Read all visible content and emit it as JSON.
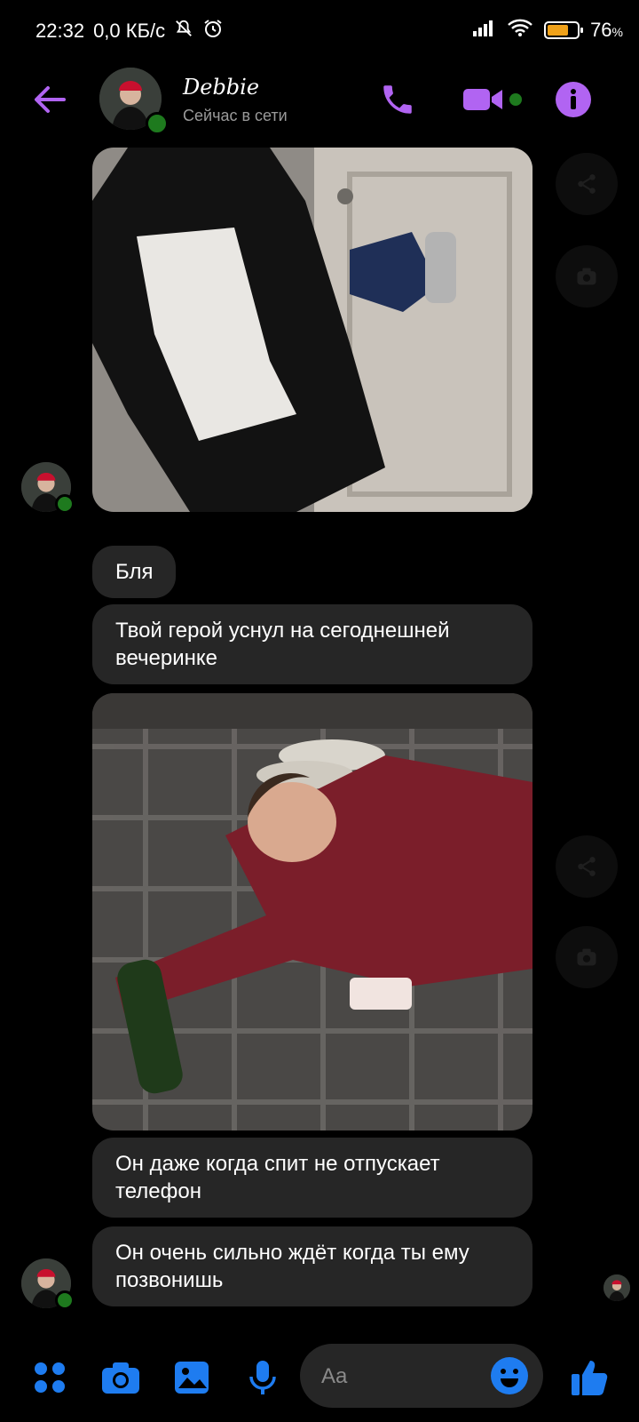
{
  "status_bar": {
    "time": "22:32",
    "speed": "0,0 КБ/с",
    "battery_percent": "76",
    "battery_suffix": "%",
    "battery_level": 0.76,
    "battery_color": "#f0a21a"
  },
  "header": {
    "name": "Debbie",
    "status": "Сейчас в сети",
    "accent_color": "#b164f2",
    "online_color": "#1e7a1e"
  },
  "messages": [
    {
      "type": "image",
      "icon": "photo-hoodie-door"
    },
    {
      "type": "text",
      "text": "Бля"
    },
    {
      "type": "text",
      "text": "Твой герой уснул на сегоднешней вечеринке"
    },
    {
      "type": "image",
      "icon": "photo-sleeping-floor"
    },
    {
      "type": "text",
      "text": "Он даже когда спит не отпускает телефон"
    },
    {
      "type": "text",
      "text": "Он очень сильно ждёт когда ты ему позвонишь"
    }
  ],
  "composer": {
    "placeholder": "Aa",
    "icon_color": "#1e7cf0"
  },
  "icons": {
    "back": "arrow-left-icon",
    "call": "phone-icon",
    "video": "video-camera-icon",
    "info": "info-icon",
    "share": "share-icon",
    "camera": "camera-icon",
    "menu": "four-dots-icon",
    "gallery": "image-icon",
    "mic": "microphone-icon",
    "emoji": "smiley-icon",
    "like": "thumbs-up-icon"
  }
}
